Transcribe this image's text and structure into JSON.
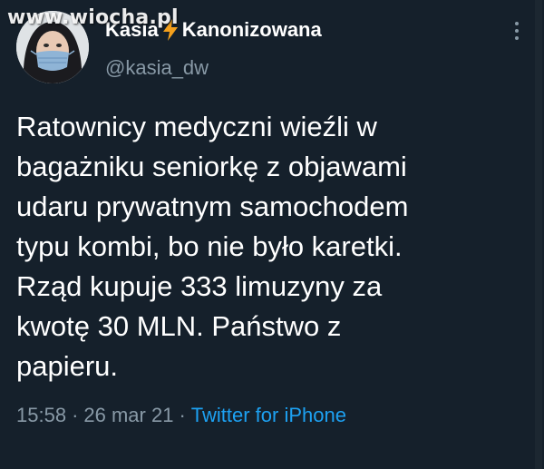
{
  "watermark": "www.wiocha.pl",
  "author": {
    "display_name": "Kasia",
    "name_suffix": "Kanonizowana",
    "handle": "@kasia_dw",
    "emoji_icon": "lightning-bolt-icon"
  },
  "tweet": {
    "text": "Ratownicy medyczni wieźli w\nbagażniku seniorkę z objawami\nudaru prywatnym samochodem\ntypu kombi, bo nie było karetki.\nRząd kupuje 333 limuzyny za\nkwotę 30 MLN. Państwo z\npapieru.",
    "time": "15:58",
    "date": "26 mar 21",
    "separator": "·",
    "source": "Twitter for iPhone"
  },
  "colors": {
    "background": "#15202b",
    "text_primary": "#ffffff",
    "text_secondary": "#8899a6",
    "link": "#1da1f2",
    "bolt": "#f4a01c"
  }
}
